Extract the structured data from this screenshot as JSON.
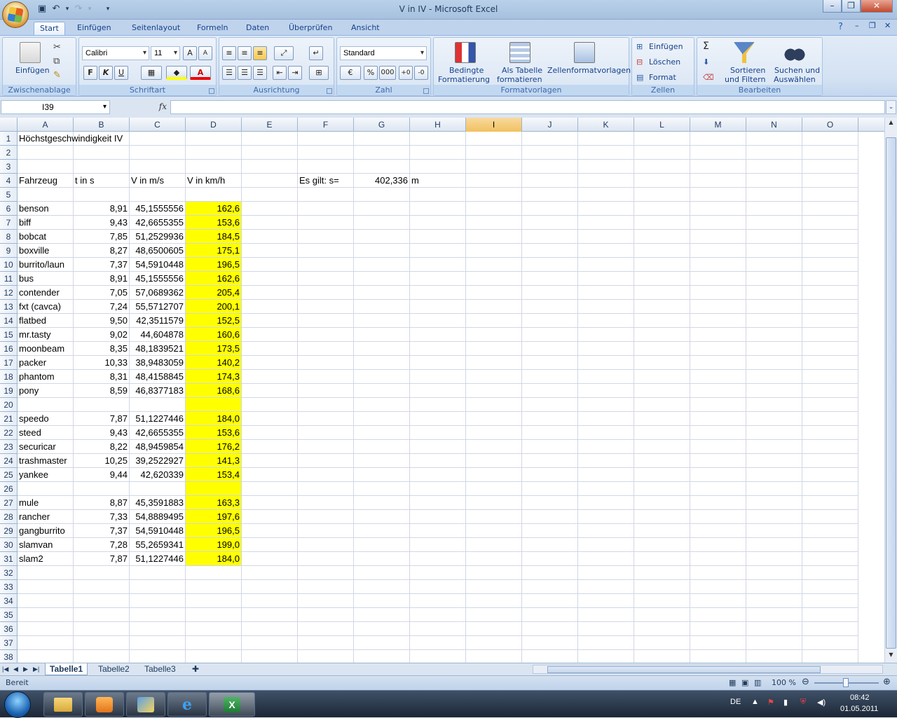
{
  "window": {
    "title": "V in IV - Microsoft Excel"
  },
  "ribbon_tabs": [
    "Start",
    "Einfügen",
    "Seitenlayout",
    "Formeln",
    "Daten",
    "Überprüfen",
    "Ansicht"
  ],
  "clipboard": {
    "paste": "Einfügen",
    "label": "Zwischenablage"
  },
  "font": {
    "name": "Calibri",
    "size": "11",
    "bold": "F",
    "italic": "K",
    "underline": "U",
    "label": "Schriftart"
  },
  "alignment": {
    "label": "Ausrichtung"
  },
  "number": {
    "format": "Standard",
    "percent": "%",
    "thousands": "000",
    "label": "Zahl"
  },
  "styles": {
    "conditional": "Bedingte",
    "conditional2": "Formatierung",
    "astable": "Als Tabelle",
    "astable2": "formatieren",
    "cellstyles": "Zellenformatvorlagen",
    "label": "Formatvorlagen"
  },
  "cells": {
    "insert": "Einfügen",
    "delete": "Löschen",
    "format": "Format",
    "label": "Zellen"
  },
  "editing": {
    "sort": "Sortieren",
    "sort2": "und Filtern",
    "find": "Suchen und",
    "find2": "Auswählen",
    "label": "Bearbeiten"
  },
  "formula_bar": {
    "name_box": "I39",
    "fx": "fx",
    "formula": ""
  },
  "columns": [
    "A",
    "B",
    "C",
    "D",
    "E",
    "F",
    "G",
    "H",
    "I",
    "J",
    "K",
    "L",
    "M",
    "N",
    "O"
  ],
  "selected_column": "I",
  "sheet": {
    "title": "Höchstgeschwindigkeit IV",
    "headers": {
      "a": "Fahrzeug",
      "b": "t in s",
      "c": "V in m/s",
      "d": "V in km/h"
    },
    "constant": {
      "label": "Es gilt: s=",
      "value": "402,336",
      "unit": "m"
    },
    "rows": [
      {
        "r": 6,
        "a": "benson",
        "b": "8,91",
        "c": "45,1555556",
        "d": "162,6"
      },
      {
        "r": 7,
        "a": "biff",
        "b": "9,43",
        "c": "42,6655355",
        "d": "153,6"
      },
      {
        "r": 8,
        "a": "bobcat",
        "b": "7,85",
        "c": "51,2529936",
        "d": "184,5"
      },
      {
        "r": 9,
        "a": "boxville",
        "b": "8,27",
        "c": "48,6500605",
        "d": "175,1"
      },
      {
        "r": 10,
        "a": "burrito/laun",
        "b": "7,37",
        "c": "54,5910448",
        "d": "196,5"
      },
      {
        "r": 11,
        "a": "bus",
        "b": "8,91",
        "c": "45,1555556",
        "d": "162,6"
      },
      {
        "r": 12,
        "a": "contender",
        "b": "7,05",
        "c": "57,0689362",
        "d": "205,4"
      },
      {
        "r": 13,
        "a": "fxt (cavca)",
        "b": "7,24",
        "c": "55,5712707",
        "d": "200,1"
      },
      {
        "r": 14,
        "a": "flatbed",
        "b": "9,50",
        "c": "42,3511579",
        "d": "152,5"
      },
      {
        "r": 15,
        "a": "mr.tasty",
        "b": "9,02",
        "c": "44,604878",
        "d": "160,6"
      },
      {
        "r": 16,
        "a": "moonbeam",
        "b": "8,35",
        "c": "48,1839521",
        "d": "173,5"
      },
      {
        "r": 17,
        "a": "packer",
        "b": "10,33",
        "c": "38,9483059",
        "d": "140,2"
      },
      {
        "r": 18,
        "a": "phantom",
        "b": "8,31",
        "c": "48,4158845",
        "d": "174,3"
      },
      {
        "r": 19,
        "a": "pony",
        "b": "8,59",
        "c": "46,8377183",
        "d": "168,6"
      },
      {
        "r": 21,
        "a": "speedo",
        "b": "7,87",
        "c": "51,1227446",
        "d": "184,0"
      },
      {
        "r": 22,
        "a": "steed",
        "b": "9,43",
        "c": "42,6655355",
        "d": "153,6"
      },
      {
        "r": 23,
        "a": "securicar",
        "b": "8,22",
        "c": "48,9459854",
        "d": "176,2"
      },
      {
        "r": 24,
        "a": "trashmaster",
        "b": "10,25",
        "c": "39,2522927",
        "d": "141,3"
      },
      {
        "r": 25,
        "a": "yankee",
        "b": "9,44",
        "c": "42,620339",
        "d": "153,4"
      },
      {
        "r": 27,
        "a": "mule",
        "b": "8,87",
        "c": "45,3591883",
        "d": "163,3"
      },
      {
        "r": 28,
        "a": "rancher",
        "b": "7,33",
        "c": "54,8889495",
        "d": "197,6"
      },
      {
        "r": 29,
        "a": "gangburrito",
        "b": "7,37",
        "c": "54,5910448",
        "d": "196,5"
      },
      {
        "r": 30,
        "a": "slamvan",
        "b": "7,28",
        "c": "55,2659341",
        "d": "199,0"
      },
      {
        "r": 31,
        "a": "slam2",
        "b": "7,87",
        "c": "51,1227446",
        "d": "184,0"
      }
    ],
    "highlight_color": "#ffff00"
  },
  "sheet_tabs": [
    "Tabelle1",
    "Tabelle2",
    "Tabelle3"
  ],
  "active_sheet": "Tabelle1",
  "status": {
    "mode": "Bereit",
    "zoom": "100 %"
  },
  "taskbar": {
    "lang": "DE",
    "time": "08:42",
    "date": "01.05.2011"
  }
}
